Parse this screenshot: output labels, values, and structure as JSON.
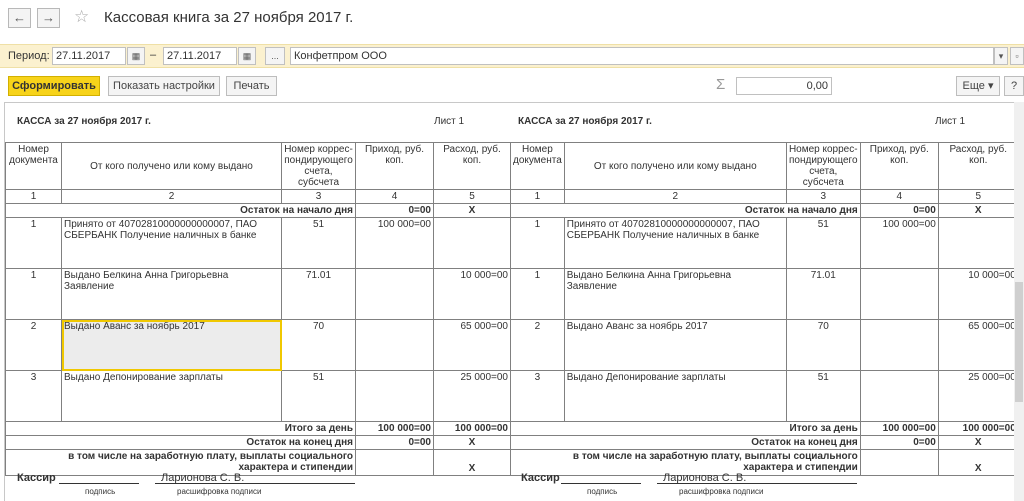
{
  "window": {
    "title": "Кассовая книга за 27 ноября 2017 г."
  },
  "filter": {
    "period_label": "Период:",
    "date_from": "27.11.2017",
    "date_to": "27.11.2017",
    "dash": "–",
    "dots": "...",
    "org": "Конфетпром ООО"
  },
  "toolbar": {
    "generate": "Сформировать",
    "show_settings": "Показать настройки",
    "print": "Печать",
    "sigma": "Σ",
    "sum": "0,00",
    "more": "Еще",
    "more_arrow": "▾",
    "help": "?"
  },
  "report": {
    "header_title": "КАССА за 27 ноября 2017 г.",
    "sheet": "Лист 1",
    "cols": [
      "Номер документа",
      "От кого получено или кому выдано",
      "Номер коррес-пондирующего счета, субсчета",
      "Приход, руб. коп.",
      "Расход, руб. коп."
    ],
    "col_nums": [
      "1",
      "2",
      "3",
      "4",
      "5"
    ],
    "opening": {
      "label": "Остаток на начало дня",
      "in": "0=00",
      "out": "X"
    },
    "rows": [
      {
        "num": "1",
        "desc": "Принято от 40702810000000000007, ПАО СБЕРБАНК Получение наличных в банке",
        "acc": "51",
        "in": "100 000=00",
        "out": ""
      },
      {
        "num": "1",
        "desc": "Выдано Белкина Анна Григорьевна Заявление",
        "acc": "71.01",
        "in": "",
        "out": "10 000=00"
      },
      {
        "num": "2",
        "desc": "Выдано Аванс за ноябрь 2017",
        "acc": "70",
        "in": "",
        "out": "65 000=00"
      },
      {
        "num": "3",
        "desc": "Выдано Депонирование зарплаты",
        "acc": "51",
        "in": "",
        "out": "25 000=00"
      }
    ],
    "total": {
      "label": "Итого за день",
      "in": "100 000=00",
      "out": "100 000=00"
    },
    "closing": {
      "label": "Остаток на конец  дня",
      "in": "0=00",
      "out": "X"
    },
    "salary": {
      "label": "в том числе на заработную плату, выплаты социального характера и стипендии",
      "out": "X"
    },
    "cashier": {
      "label": "Кассир",
      "name": "Ларионова С. В.",
      "sign_caption": "подпись",
      "decode_caption": "расшифровка подписи"
    }
  }
}
